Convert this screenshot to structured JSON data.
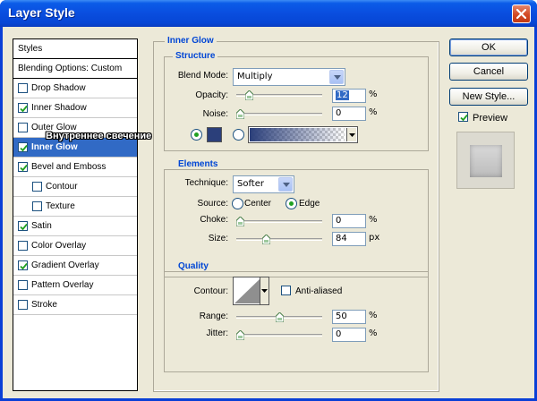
{
  "window": {
    "title": "Layer Style"
  },
  "styles_panel": {
    "items": [
      {
        "label": "Styles",
        "type": "plain"
      },
      {
        "label": "Blending Options: Custom",
        "type": "plain"
      },
      {
        "label": "Drop Shadow",
        "checked": false
      },
      {
        "label": "Inner Shadow",
        "checked": true
      },
      {
        "label": "Outer Glow",
        "checked": false
      },
      {
        "label": "Inner Glow",
        "checked": true,
        "selected": true
      },
      {
        "label": "Bevel and Emboss",
        "checked": true
      },
      {
        "label": "Contour",
        "checked": false,
        "indent": true
      },
      {
        "label": "Texture",
        "checked": false,
        "indent": true
      },
      {
        "label": "Satin",
        "checked": true
      },
      {
        "label": "Color Overlay",
        "checked": false
      },
      {
        "label": "Gradient Overlay",
        "checked": true
      },
      {
        "label": "Pattern Overlay",
        "checked": false
      },
      {
        "label": "Stroke",
        "checked": false
      }
    ]
  },
  "overlay_caption": "Внутреннее свечение",
  "inner_glow": {
    "title": "Inner Glow",
    "structure": {
      "title": "Structure",
      "blend_mode_label": "Blend Mode:",
      "blend_mode_value": "Multiply",
      "opacity_label": "Opacity:",
      "opacity_value": "12",
      "opacity_unit": "%",
      "opacity_level": 12,
      "noise_label": "Noise:",
      "noise_value": "0",
      "noise_unit": "%",
      "noise_level": 0,
      "glow_color": "#2b3f7a",
      "color_selected": true
    },
    "elements": {
      "title": "Elements",
      "technique_label": "Technique:",
      "technique_value": "Softer",
      "source_label": "Source:",
      "source_center": "Center",
      "source_edge": "Edge",
      "source_selected": "Edge",
      "choke_label": "Choke:",
      "choke_value": "0",
      "choke_unit": "%",
      "choke_level": 0,
      "size_label": "Size:",
      "size_value": "84",
      "size_unit": "px",
      "size_level": 33.6
    },
    "quality": {
      "title": "Quality",
      "contour_label": "Contour:",
      "anti_aliased_label": "Anti-aliased",
      "anti_aliased_checked": false,
      "range_label": "Range:",
      "range_value": "50",
      "range_unit": "%",
      "range_level": 50,
      "jitter_label": "Jitter:",
      "jitter_value": "0",
      "jitter_unit": "%",
      "jitter_level": 0
    }
  },
  "buttons": {
    "ok": "OK",
    "cancel": "Cancel",
    "new_style": "New Style...",
    "preview_label": "Preview",
    "preview_checked": true
  },
  "colors": {
    "accent": "#0046d5",
    "selection": "#316ac5",
    "titlebar": "#0a4fe0"
  }
}
